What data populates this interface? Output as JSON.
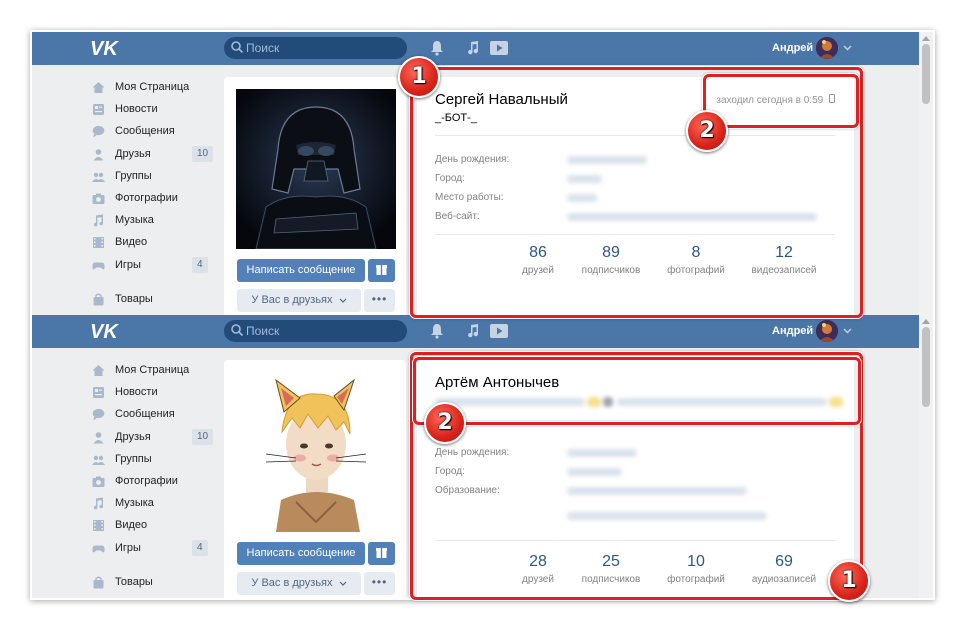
{
  "app": {
    "brand": "VK",
    "search_placeholder": "Поиск",
    "user_name": "Андрей"
  },
  "menu": [
    {
      "icon": "home-icon",
      "label": "Моя Страница",
      "count": ""
    },
    {
      "icon": "news-icon",
      "label": "Новости",
      "count": ""
    },
    {
      "icon": "messages-icon",
      "label": "Сообщения",
      "count": ""
    },
    {
      "icon": "friends-icon",
      "label": "Друзья",
      "count": "10"
    },
    {
      "icon": "groups-icon",
      "label": "Группы",
      "count": ""
    },
    {
      "icon": "photos-icon",
      "label": "Фотографии",
      "count": ""
    },
    {
      "icon": "music-icon",
      "label": "Музыка",
      "count": ""
    },
    {
      "icon": "video-icon",
      "label": "Видео",
      "count": ""
    },
    {
      "icon": "games-icon",
      "label": "Игры",
      "count": "4"
    },
    {
      "icon": "market-icon",
      "label": "Товары",
      "count": ""
    }
  ],
  "buttons": {
    "message": "Написать сообщение",
    "in_friends": "У Вас в друзьях",
    "more": "•••"
  },
  "profile1": {
    "name": "Сергей Навальный",
    "status": "_-БОТ-_",
    "online": "заходил сегодня в 0:59",
    "fields": [
      "День рождения:",
      "Город:",
      "Место работы:",
      "Веб-сайт:"
    ],
    "stats": [
      {
        "num": "86",
        "label": "друзей"
      },
      {
        "num": "89",
        "label": "подписчиков"
      },
      {
        "num": "8",
        "label": "фотографий"
      },
      {
        "num": "12",
        "label": "видеозаписей"
      }
    ]
  },
  "profile2": {
    "name": "Артём Антонычев",
    "fields": [
      "День рождения:",
      "Город:",
      "Образование:"
    ],
    "stats": [
      {
        "num": "28",
        "label": "друзей"
      },
      {
        "num": "25",
        "label": "подписчиков"
      },
      {
        "num": "10",
        "label": "фотографий"
      },
      {
        "num": "69",
        "label": "аудиозаписей"
      }
    ]
  },
  "annotations": {
    "badge_one": "1",
    "badge_two": "2",
    "color": "#e02020"
  }
}
